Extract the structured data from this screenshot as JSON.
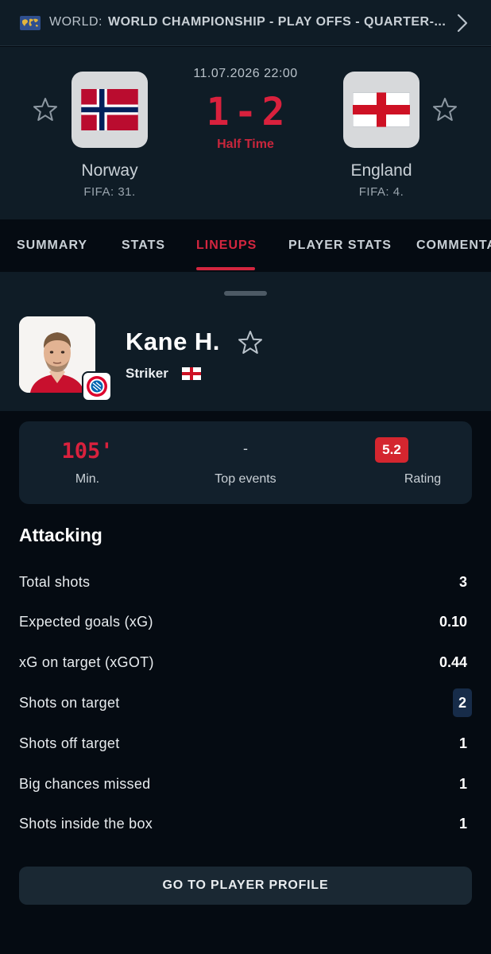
{
  "competition": {
    "country": "WORLD:",
    "name": "WORLD CHAMPIONSHIP - PLAY OFFS - QUARTER-..."
  },
  "match": {
    "datetime": "11.07.2026 22:00",
    "home": {
      "name": "Norway",
      "fifa": "FIFA: 31."
    },
    "away": {
      "name": "England",
      "fifa": "FIFA: 4."
    },
    "score": {
      "home": "1",
      "separator": "-",
      "away": "2"
    },
    "status": "Half Time"
  },
  "tabs": [
    {
      "label": "SUMMARY"
    },
    {
      "label": "STATS"
    },
    {
      "label": "LINEUPS"
    },
    {
      "label": "PLAYER STATS"
    },
    {
      "label": "COMMENTA"
    }
  ],
  "player": {
    "name": "Kane H.",
    "position": "Striker"
  },
  "summary": {
    "minutes": "105'",
    "minutes_label": "Min.",
    "top_events": "-",
    "top_events_label": "Top events",
    "rating": "5.2",
    "rating_label": "Rating"
  },
  "attacking": {
    "title": "Attacking",
    "stats": [
      {
        "label": "Total shots",
        "value": "3"
      },
      {
        "label": "Expected goals (xG)",
        "value": "0.10"
      },
      {
        "label": "xG on target (xGOT)",
        "value": "0.44"
      },
      {
        "label": "Shots on target",
        "value": "2"
      },
      {
        "label": "Shots off target",
        "value": "1"
      },
      {
        "label": "Big chances missed",
        "value": "1"
      },
      {
        "label": "Shots inside the box",
        "value": "1"
      }
    ]
  },
  "profile_button": "GO TO PLAYER PROFILE",
  "colors": {
    "accent_red": "#d4263f",
    "header_bg": "#0f1c26",
    "page_bg": "#050b12",
    "rating_bg": "#d4262f"
  },
  "icons": [
    "world-flag-icon",
    "chevron-right-icon",
    "star-icon",
    "norway-flag-icon",
    "england-flag-icon",
    "bayern-badge-icon"
  ]
}
